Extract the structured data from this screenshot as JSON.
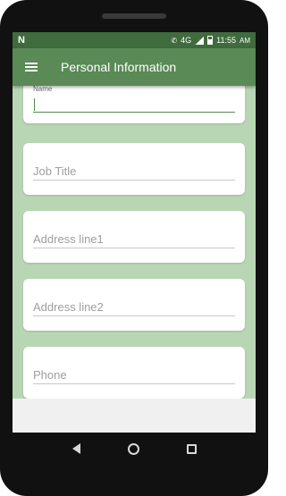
{
  "status_bar": {
    "notification_icon": "N",
    "network_label": "4G",
    "time": "11:55",
    "time_suffix": "AM"
  },
  "app_bar": {
    "menu_icon": "hamburger-menu-icon",
    "title": "Personal Information"
  },
  "form": {
    "fields": [
      {
        "label": "Name",
        "value": "",
        "placeholder": ""
      },
      {
        "placeholder": "Job Title"
      },
      {
        "placeholder": "Address line1"
      },
      {
        "placeholder": "Address line2"
      },
      {
        "placeholder": "Phone"
      }
    ]
  },
  "nav_bar": {
    "icons": [
      "back-icon",
      "home-icon",
      "recents-icon"
    ]
  },
  "colors": {
    "status_bar": "#3f6b3e",
    "app_bar": "#5a8a56",
    "background": "#b9d6b4",
    "accent": "#5a8a56"
  }
}
